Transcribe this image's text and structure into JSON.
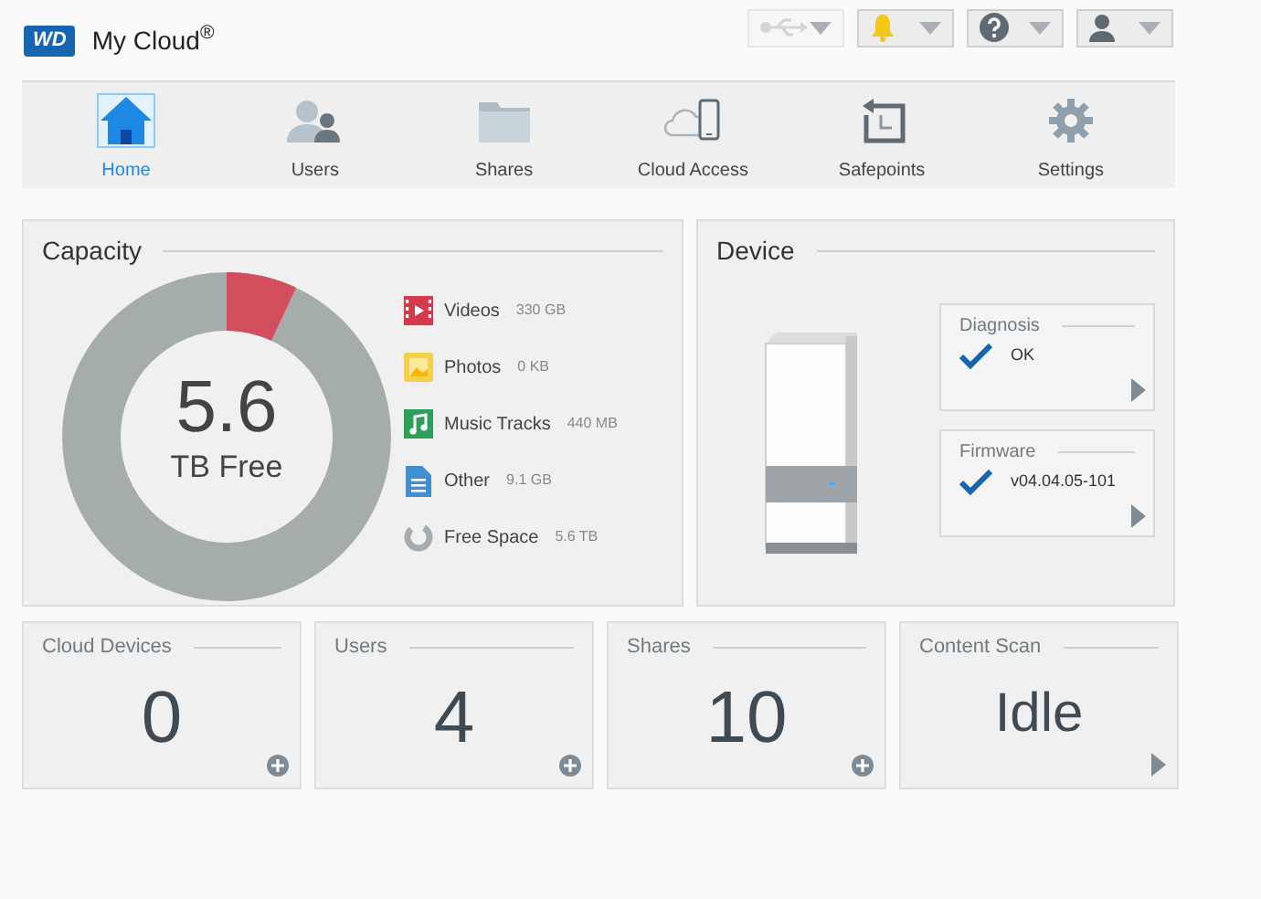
{
  "header": {
    "logo": "WD",
    "title": "My Cloud$^{®}$",
    "tools": [
      {
        "kind": "usb",
        "disabled": true
      },
      {
        "kind": "bell",
        "disabled": false
      },
      {
        "kind": "help",
        "disabled": false
      },
      {
        "kind": "user",
        "disabled": false
      }
    ]
  },
  "nav": [
    {
      "kind": "home",
      "label": "Home",
      "selected": true
    },
    {
      "kind": "users",
      "label": "Users",
      "selected": false
    },
    {
      "kind": "shares",
      "label": "Shares",
      "selected": false
    },
    {
      "kind": "cloud",
      "label": "Cloud Access",
      "selected": false
    },
    {
      "kind": "safepoints",
      "label": "Safepoints",
      "selected": false
    },
    {
      "kind": "settings",
      "label": "Settings",
      "selected": false
    }
  ],
  "capacity": {
    "title": "Capacity",
    "value": "5.6",
    "unit": "TB Free",
    "legend": [
      {
        "kind": "video",
        "label": "Videos",
        "amount": "330 GB"
      },
      {
        "kind": "photo",
        "label": "Photos",
        "amount": "0 KB"
      },
      {
        "kind": "music",
        "label": "Music Tracks",
        "amount": "440 MB"
      },
      {
        "kind": "document",
        "label": "Other",
        "amount": "9.1 GB"
      },
      {
        "kind": "free",
        "label": "Free Space",
        "amount": "5.6 TB"
      }
    ]
  },
  "device": {
    "title": "Device",
    "status": [
      {
        "title": "Diagnosis",
        "value": "OK"
      },
      {
        "title": "Firmware",
        "value": "v04.04.05-101"
      }
    ]
  },
  "cards": [
    {
      "title": "Cloud Devices",
      "value": "0",
      "kind": "add"
    },
    {
      "title": "Users",
      "value": "4",
      "kind": "add"
    },
    {
      "title": "Shares",
      "value": "10",
      "kind": "add"
    },
    {
      "title": "Content Scan",
      "value": "Idle",
      "kind": "more"
    }
  ]
}
